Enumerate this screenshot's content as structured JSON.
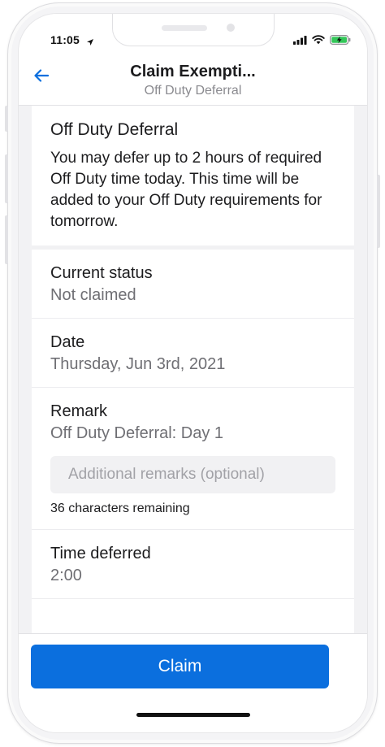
{
  "status_bar": {
    "time": "11:05"
  },
  "nav": {
    "title": "Claim Exempti...",
    "subtitle": "Off Duty Deferral"
  },
  "intro": {
    "title": "Off Duty Deferral",
    "body": "You may defer up to 2 hours of required Off Duty time today. This time will be added to your Off Duty requirements for tomorrow."
  },
  "rows": {
    "status": {
      "label": "Current status",
      "value": "Not claimed"
    },
    "date": {
      "label": "Date",
      "value": "Thursday, Jun 3rd, 2021"
    },
    "remark": {
      "label": "Remark",
      "value": "Off Duty Deferral: Day 1",
      "input_value": "",
      "input_placeholder": "Additional remarks (optional)",
      "chars_remaining": "36 characters remaining"
    },
    "time_deferred": {
      "label": "Time deferred",
      "value": "2:00"
    }
  },
  "claim_button": {
    "label": "Claim"
  },
  "colors": {
    "accent": "#0b6fde",
    "battery": "#34c759"
  }
}
